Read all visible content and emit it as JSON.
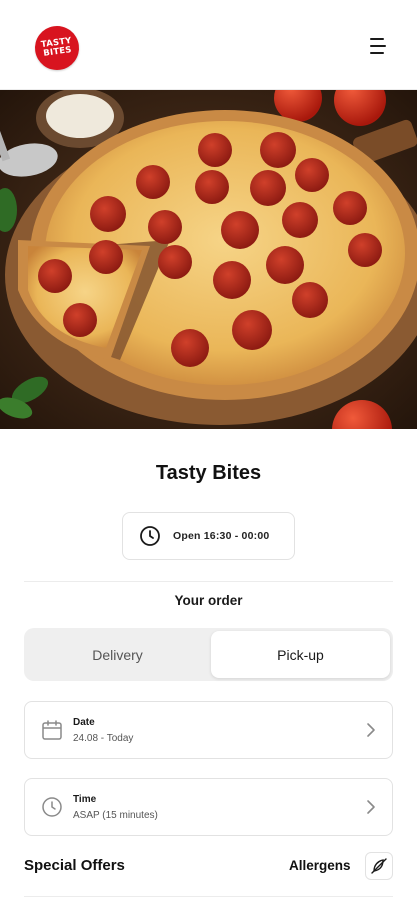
{
  "header": {
    "logo_line1": "TASTY",
    "logo_line2": "BITES",
    "menu_icon": "hamburger-menu-icon"
  },
  "hero": {
    "image": "pepperoni-pizza-photo"
  },
  "restaurant": {
    "name": "Tasty Bites",
    "hours": "Open 16:30 - 00:00"
  },
  "order": {
    "heading": "Your order",
    "modes": [
      "Delivery",
      "Pick-up"
    ],
    "selected_mode": "Pick-up",
    "date_label": "Date",
    "date_value": "24.08 - Today",
    "time_label": "Time",
    "time_value": "ASAP (15 minutes)"
  },
  "sections": {
    "special_offers": "Special Offers",
    "allergens": "Allergens"
  },
  "colors": {
    "brand": "#d8141f"
  }
}
